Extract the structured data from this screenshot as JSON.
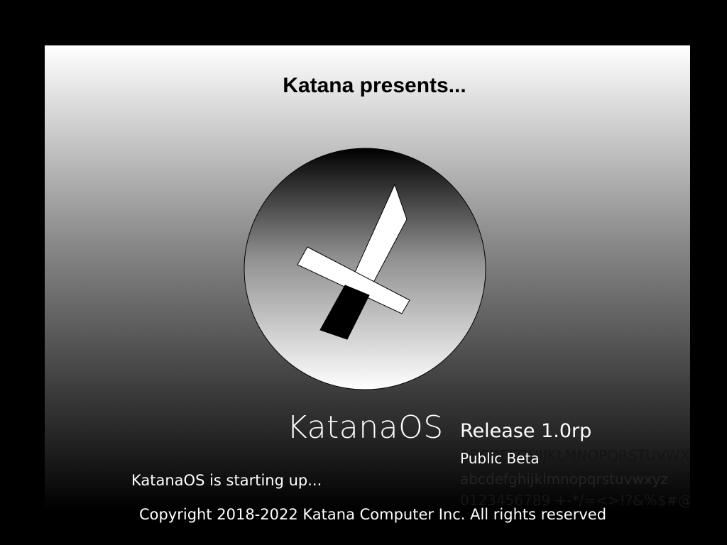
{
  "splash": {
    "presents_title": "Katana presents...",
    "logo_icon": "katana-sword-icon",
    "os_name": "KatanaOS",
    "release": "Release 1.0rp",
    "channel": "Public Beta",
    "font_sample": {
      "uppercase": "ABCDEFGHIJKLMNOPQRSTUVWXYZ",
      "lowercase": "abcdefghijklmnopqrstuvwxyz",
      "digits": "0123456789 +-*/=<>!?&%$#@"
    },
    "status": "KatanaOS is starting up..."
  },
  "footer": {
    "copyright": "Copyright 2018-2022 Katana Computer Inc. All rights reserved"
  },
  "colors": {
    "background": "#000000",
    "gradient_top": "#ffffff",
    "gradient_bottom": "#000000",
    "text_light": "#ffffff",
    "text_dark": "#000000"
  }
}
